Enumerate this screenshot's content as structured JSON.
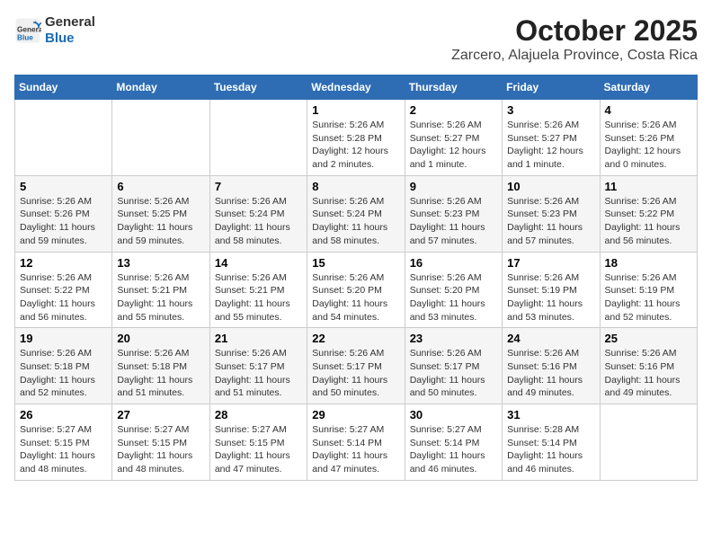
{
  "header": {
    "logo_line1": "General",
    "logo_line2": "Blue",
    "title": "October 2025",
    "subtitle": "Zarcero, Alajuela Province, Costa Rica"
  },
  "days_of_week": [
    "Sunday",
    "Monday",
    "Tuesday",
    "Wednesday",
    "Thursday",
    "Friday",
    "Saturday"
  ],
  "weeks": [
    [
      {
        "day": "",
        "info": ""
      },
      {
        "day": "",
        "info": ""
      },
      {
        "day": "",
        "info": ""
      },
      {
        "day": "1",
        "info": "Sunrise: 5:26 AM\nSunset: 5:28 PM\nDaylight: 12 hours and 2 minutes."
      },
      {
        "day": "2",
        "info": "Sunrise: 5:26 AM\nSunset: 5:27 PM\nDaylight: 12 hours and 1 minute."
      },
      {
        "day": "3",
        "info": "Sunrise: 5:26 AM\nSunset: 5:27 PM\nDaylight: 12 hours and 1 minute."
      },
      {
        "day": "4",
        "info": "Sunrise: 5:26 AM\nSunset: 5:26 PM\nDaylight: 12 hours and 0 minutes."
      }
    ],
    [
      {
        "day": "5",
        "info": "Sunrise: 5:26 AM\nSunset: 5:26 PM\nDaylight: 11 hours and 59 minutes."
      },
      {
        "day": "6",
        "info": "Sunrise: 5:26 AM\nSunset: 5:25 PM\nDaylight: 11 hours and 59 minutes."
      },
      {
        "day": "7",
        "info": "Sunrise: 5:26 AM\nSunset: 5:24 PM\nDaylight: 11 hours and 58 minutes."
      },
      {
        "day": "8",
        "info": "Sunrise: 5:26 AM\nSunset: 5:24 PM\nDaylight: 11 hours and 58 minutes."
      },
      {
        "day": "9",
        "info": "Sunrise: 5:26 AM\nSunset: 5:23 PM\nDaylight: 11 hours and 57 minutes."
      },
      {
        "day": "10",
        "info": "Sunrise: 5:26 AM\nSunset: 5:23 PM\nDaylight: 11 hours and 57 minutes."
      },
      {
        "day": "11",
        "info": "Sunrise: 5:26 AM\nSunset: 5:22 PM\nDaylight: 11 hours and 56 minutes."
      }
    ],
    [
      {
        "day": "12",
        "info": "Sunrise: 5:26 AM\nSunset: 5:22 PM\nDaylight: 11 hours and 56 minutes."
      },
      {
        "day": "13",
        "info": "Sunrise: 5:26 AM\nSunset: 5:21 PM\nDaylight: 11 hours and 55 minutes."
      },
      {
        "day": "14",
        "info": "Sunrise: 5:26 AM\nSunset: 5:21 PM\nDaylight: 11 hours and 55 minutes."
      },
      {
        "day": "15",
        "info": "Sunrise: 5:26 AM\nSunset: 5:20 PM\nDaylight: 11 hours and 54 minutes."
      },
      {
        "day": "16",
        "info": "Sunrise: 5:26 AM\nSunset: 5:20 PM\nDaylight: 11 hours and 53 minutes."
      },
      {
        "day": "17",
        "info": "Sunrise: 5:26 AM\nSunset: 5:19 PM\nDaylight: 11 hours and 53 minutes."
      },
      {
        "day": "18",
        "info": "Sunrise: 5:26 AM\nSunset: 5:19 PM\nDaylight: 11 hours and 52 minutes."
      }
    ],
    [
      {
        "day": "19",
        "info": "Sunrise: 5:26 AM\nSunset: 5:18 PM\nDaylight: 11 hours and 52 minutes."
      },
      {
        "day": "20",
        "info": "Sunrise: 5:26 AM\nSunset: 5:18 PM\nDaylight: 11 hours and 51 minutes."
      },
      {
        "day": "21",
        "info": "Sunrise: 5:26 AM\nSunset: 5:17 PM\nDaylight: 11 hours and 51 minutes."
      },
      {
        "day": "22",
        "info": "Sunrise: 5:26 AM\nSunset: 5:17 PM\nDaylight: 11 hours and 50 minutes."
      },
      {
        "day": "23",
        "info": "Sunrise: 5:26 AM\nSunset: 5:17 PM\nDaylight: 11 hours and 50 minutes."
      },
      {
        "day": "24",
        "info": "Sunrise: 5:26 AM\nSunset: 5:16 PM\nDaylight: 11 hours and 49 minutes."
      },
      {
        "day": "25",
        "info": "Sunrise: 5:26 AM\nSunset: 5:16 PM\nDaylight: 11 hours and 49 minutes."
      }
    ],
    [
      {
        "day": "26",
        "info": "Sunrise: 5:27 AM\nSunset: 5:15 PM\nDaylight: 11 hours and 48 minutes."
      },
      {
        "day": "27",
        "info": "Sunrise: 5:27 AM\nSunset: 5:15 PM\nDaylight: 11 hours and 48 minutes."
      },
      {
        "day": "28",
        "info": "Sunrise: 5:27 AM\nSunset: 5:15 PM\nDaylight: 11 hours and 47 minutes."
      },
      {
        "day": "29",
        "info": "Sunrise: 5:27 AM\nSunset: 5:14 PM\nDaylight: 11 hours and 47 minutes."
      },
      {
        "day": "30",
        "info": "Sunrise: 5:27 AM\nSunset: 5:14 PM\nDaylight: 11 hours and 46 minutes."
      },
      {
        "day": "31",
        "info": "Sunrise: 5:28 AM\nSunset: 5:14 PM\nDaylight: 11 hours and 46 minutes."
      },
      {
        "day": "",
        "info": ""
      }
    ]
  ]
}
